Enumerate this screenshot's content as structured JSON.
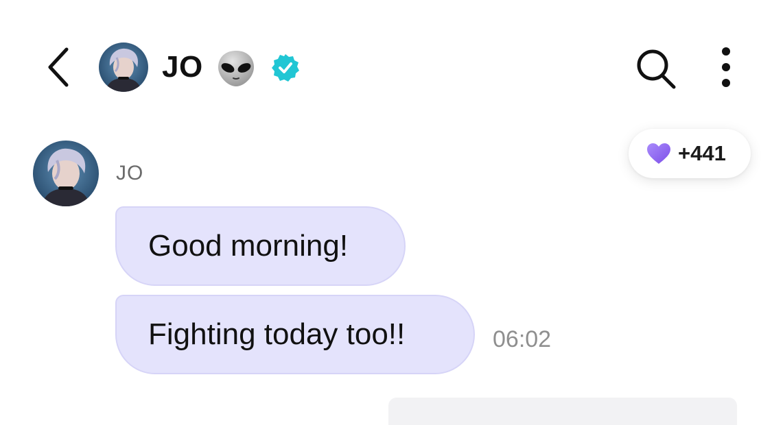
{
  "header": {
    "title": "JO",
    "title_emoji": "👽",
    "verified": true,
    "icons": {
      "back": "chevron-left-icon",
      "search": "search-icon",
      "more": "more-vertical-icon",
      "verified": "verified-badge-icon"
    }
  },
  "reactions": {
    "heart_count": "+441",
    "heart_color": "#8b5cf6"
  },
  "conversation": {
    "sender_name": "JO",
    "messages": [
      {
        "text": "Good morning!"
      },
      {
        "text": "Fighting today too!!"
      }
    ],
    "timestamp": "06:02"
  },
  "colors": {
    "bubble_bg": "#e4e3fc",
    "bubble_border": "#d6d4f7",
    "verified_badge": "#21c6d4",
    "accent": "#8b5cf6"
  }
}
